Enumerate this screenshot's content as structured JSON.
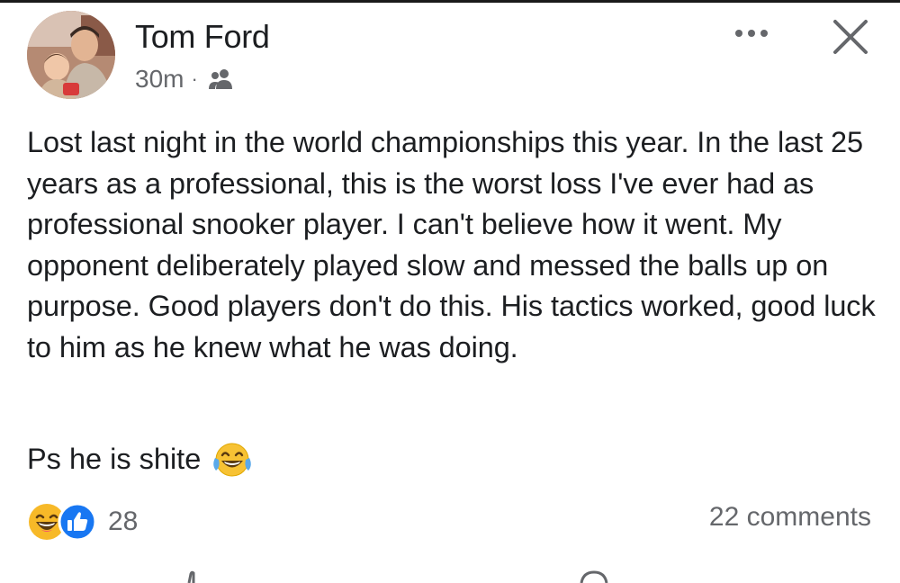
{
  "post": {
    "author": "Tom Ford",
    "time": "30m",
    "separator": "·",
    "audience_icon": "friends-icon",
    "body": "Lost last night in the world championships this year. In the last 25 years as a professional, this is the worst loss I've ever had as professional snooker player. I can't believe how it went. My opponent deliberately played slow and messed the balls up on purpose. Good players don't do this. His tactics worked, good luck to him as he knew what he was doing.",
    "ps": "Ps he is shite",
    "ps_emoji": "tears-of-joy-emoji"
  },
  "reactions": {
    "types": [
      "haha",
      "like"
    ],
    "count": "28"
  },
  "comments": {
    "label": "22 comments"
  },
  "colors": {
    "text": "#1c1e21",
    "secondary": "#65676b",
    "like_blue": "#1877f2",
    "haha_yellow": "#f7b928"
  }
}
